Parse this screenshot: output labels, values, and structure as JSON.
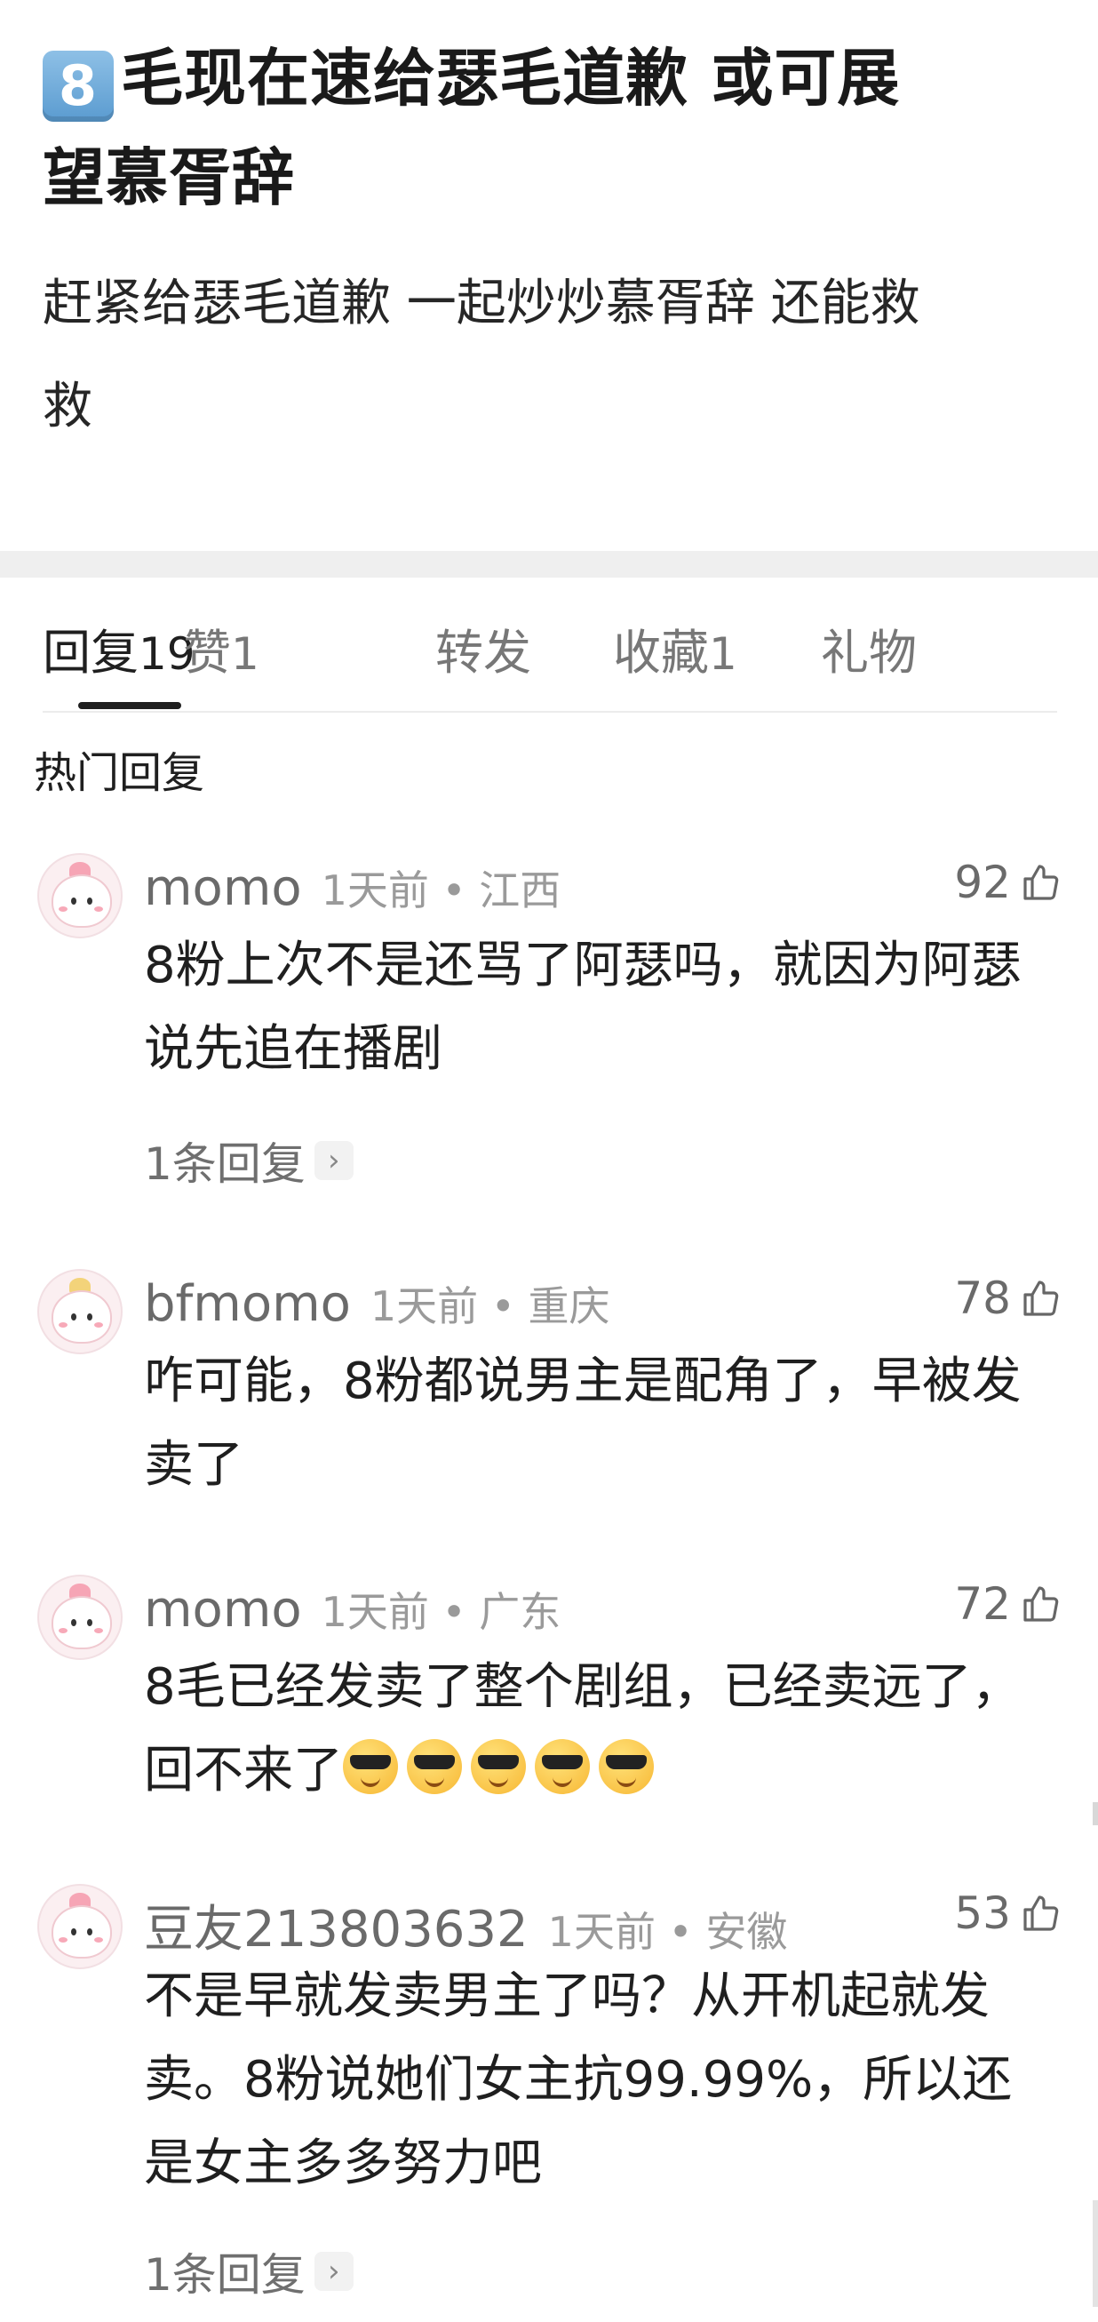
{
  "post": {
    "keycap": "8",
    "title_line1": "毛现在速给瑟毛道歉 或可展",
    "title_line2": "望慕胥辞",
    "body_line1": "赶紧给瑟毛道歉 一起炒炒慕胥辞 还能救",
    "body_line2": "救"
  },
  "tabs": [
    {
      "label": "回复",
      "count": "19",
      "active": true
    },
    {
      "label": "赞",
      "count": "1",
      "active": false
    },
    {
      "label": "转发",
      "count": "",
      "active": false
    },
    {
      "label": "收藏",
      "count": "1",
      "active": false
    },
    {
      "label": "礼物",
      "count": "",
      "active": false
    }
  ],
  "section_label": "热门回复",
  "comments": [
    {
      "user": "momo",
      "time": "1天前 • 江西",
      "likes": "92",
      "line1": "8粉上次不是还骂了阿瑟吗，就因为阿瑟",
      "line2": "说先追在播剧",
      "line3": "",
      "replies": "1条回复"
    },
    {
      "user": "bfmomo",
      "time": "1天前 • 重庆",
      "likes": "78",
      "line1": "咋可能，8粉都说男主是配角了，早被发",
      "line2": "卖了",
      "line3": "",
      "replies": ""
    },
    {
      "user": "momo",
      "time": "1天前 • 广东",
      "likes": "72",
      "line1": "8毛已经发卖了整个剧组，已经卖远了，",
      "line2": "回不来了",
      "line3": "",
      "replies": "",
      "emoji": "😎😎😎😎😎"
    },
    {
      "user": "豆友213803632",
      "time": "1天前 • 安徽",
      "likes": "53",
      "line1": "不是早就发卖男主了吗？从开机起就发",
      "line2": "卖。8粉说她们女主抗99.99%，所以还",
      "line3": "是女主多多努力吧",
      "replies": "1条回复"
    }
  ],
  "icons": {
    "like": "thumbs-up-icon",
    "chevron": "chevron-right-icon",
    "emoji": "sunglasses-face-emoji"
  }
}
